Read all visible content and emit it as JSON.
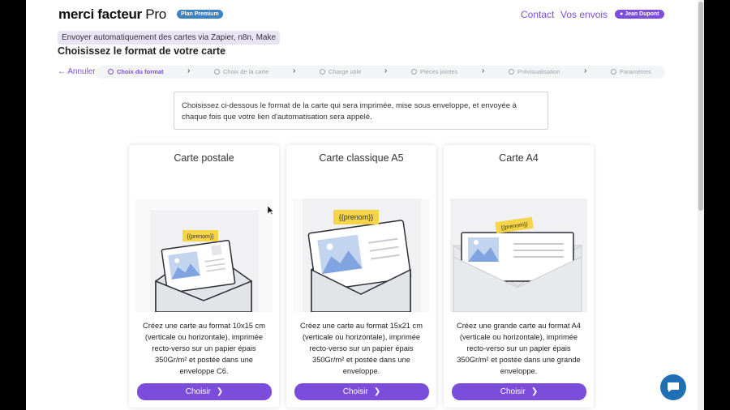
{
  "header": {
    "logo_main": "merci facteur",
    "logo_pro": " Pro",
    "plan_badge": "Plan Premium",
    "nav_contact": "Contact",
    "nav_envois": "Vos envois",
    "user_name": "Jean Dupont",
    "user_icon": "user-icon"
  },
  "subtitle_badge": "Envoyer automatiquement des cartes via Zapier, n8n, Make",
  "page_title": "Choisissez le format de votre carte",
  "stepper": {
    "cancel_label": "Annuler",
    "steps": [
      {
        "label": "Choix du format",
        "active": true
      },
      {
        "label": "Choix de la carte",
        "active": false
      },
      {
        "label": "Charge utile",
        "active": false
      },
      {
        "label": "Pièces jointes",
        "active": false
      },
      {
        "label": "Prévisualisation",
        "active": false
      },
      {
        "label": "Paramètres",
        "active": false
      }
    ]
  },
  "intro_text": "Choisissez ci-dessous le format de la carte qui sera imprimée, mise sous enveloppe, et envoyée à chaque fois que votre lien d'automatisation sera appelé.",
  "cards": [
    {
      "title": "Carte postale",
      "tag": "{{prenom}}",
      "description": "Créez une carte au format 10x15 cm (verticale ou horizontale), imprimée recto-verso sur un papier épais 350Gr/m² et postée dans une enveloppe C6.",
      "button_label": "Choisir"
    },
    {
      "title": "Carte classique A5",
      "tag": "{{prenom}}",
      "description": "Créez une carte au format 15x21 cm (verticale ou horizontale), imprimée recto-verso sur un papier épais 350Gr/m² et postée dans une enveloppe.",
      "button_label": "Choisir"
    },
    {
      "title": "Carte A4",
      "tag": "{{prenom}}",
      "description": "Créez une grande carte au format A4 (verticale ou horizontale), imprimée recto-verso sur un papier épais 350Gr/m² et postée dans une grande enveloppe.",
      "button_label": "Choisir"
    }
  ],
  "colors": {
    "accent": "#7c4ddb",
    "plan_badge": "#3b82c4",
    "chat": "#1f6fb5",
    "tag_yellow": "#f5d547"
  }
}
